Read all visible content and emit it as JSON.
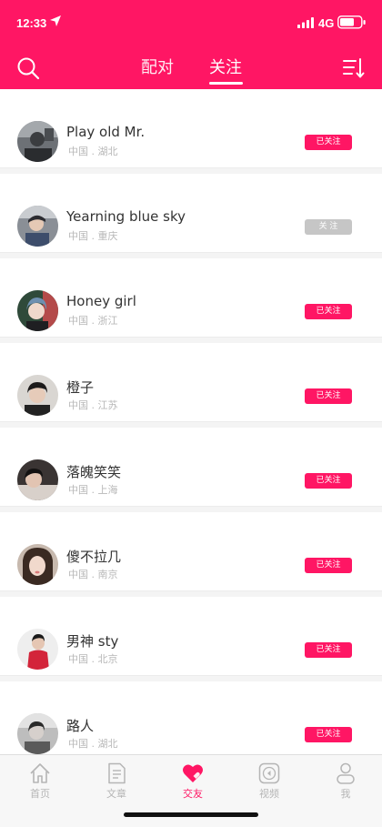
{
  "status": {
    "time": "12:33",
    "network": "4G"
  },
  "header": {
    "tabs": [
      {
        "label": "配对"
      },
      {
        "label": "关注"
      }
    ],
    "active_tab": 1,
    "accent_color": "#ff1664"
  },
  "users": [
    {
      "name": "Play old Mr.",
      "location": "中国 . 湖北",
      "follow_label": "已关注",
      "followed": true
    },
    {
      "name": "Yearning blue sky",
      "location": "中国 . 重庆",
      "follow_label": "关 注",
      "followed": false
    },
    {
      "name": "Honey girl",
      "location": "中国 . 浙江",
      "follow_label": "已关注",
      "followed": true
    },
    {
      "name": "橙子",
      "location": "中国 . 江苏",
      "follow_label": "已关注",
      "followed": true
    },
    {
      "name": "落魄笑笑",
      "location": "中国 . 上海",
      "follow_label": "已关注",
      "followed": true
    },
    {
      "name": "傻不拉几",
      "location": "中国 . 南京",
      "follow_label": "已关注",
      "followed": true
    },
    {
      "name": "男神 sty",
      "location": "中国 . 北京",
      "follow_label": "已关注",
      "followed": true
    },
    {
      "name": "路人",
      "location": "中国 . 湖北",
      "follow_label": "已关注",
      "followed": true
    }
  ],
  "tabbar": {
    "items": [
      {
        "label": "首页",
        "icon": "home-icon"
      },
      {
        "label": "文章",
        "icon": "article-icon"
      },
      {
        "label": "交友",
        "icon": "heart-icon"
      },
      {
        "label": "视频",
        "icon": "video-icon"
      },
      {
        "label": "我",
        "icon": "person-icon"
      }
    ],
    "active_index": 2
  }
}
